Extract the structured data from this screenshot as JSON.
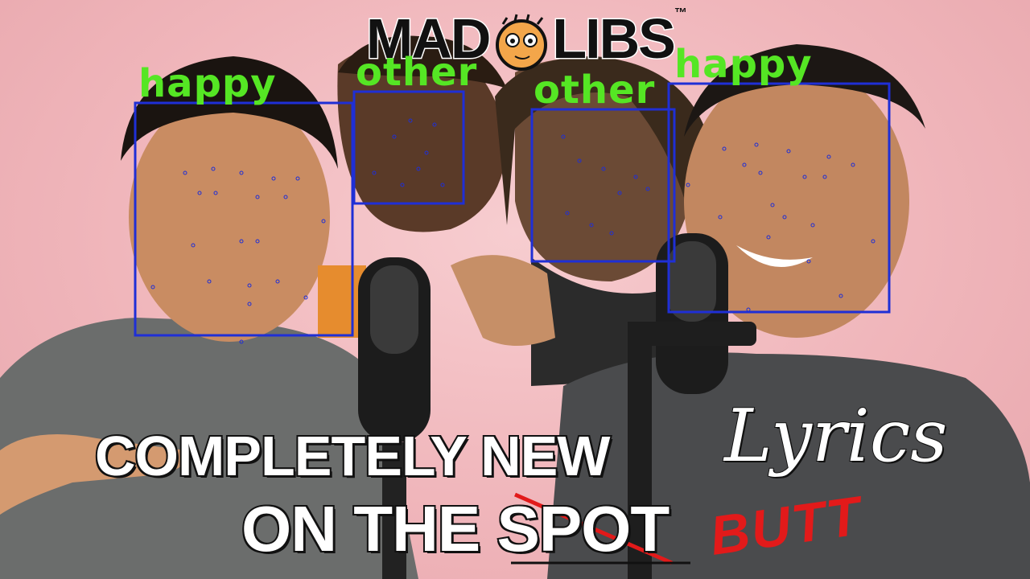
{
  "brand": {
    "left": "MAD",
    "right": "LIBS",
    "tm": "™"
  },
  "detections": [
    {
      "label": "happy"
    },
    {
      "label": "other"
    },
    {
      "label": "other"
    },
    {
      "label": "happy"
    }
  ],
  "title": {
    "line1": "COMPLETELY NEW",
    "lyrics": "Lyrics",
    "line2_prefix": "ON THE ",
    "struck_word": "SPOT",
    "replacement": "BUTT"
  },
  "colors": {
    "box": "#1f2fd6",
    "label": "#55e624",
    "strike": "#e21a1a"
  }
}
